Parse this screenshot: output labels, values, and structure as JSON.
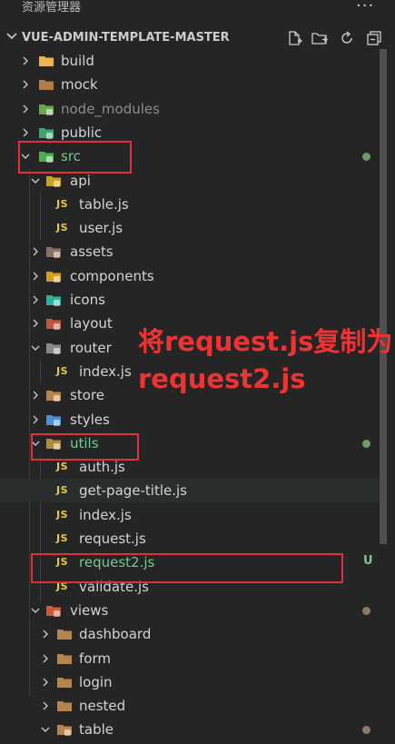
{
  "panel": {
    "title": "资源管理器",
    "more_icon": "ellipsis-icon"
  },
  "project": {
    "name": "VUE-ADMIN-TEMPLATE-MASTER",
    "actions": [
      "new-file-icon",
      "new-folder-icon",
      "refresh-icon",
      "collapse-all-icon"
    ]
  },
  "tree": [
    {
      "label": "build",
      "type": "folder",
      "depth": 0,
      "expanded": false,
      "icon": "folder-yellow"
    },
    {
      "label": "mock",
      "type": "folder",
      "depth": 0,
      "expanded": false,
      "icon": "folder-brown"
    },
    {
      "label": "node_modules",
      "type": "folder",
      "depth": 0,
      "expanded": false,
      "icon": "folder-node",
      "dim": true
    },
    {
      "label": "public",
      "type": "folder",
      "depth": 0,
      "expanded": false,
      "icon": "folder-public"
    },
    {
      "label": "src",
      "type": "folder",
      "depth": 0,
      "expanded": true,
      "icon": "folder-src",
      "status": "green-dot",
      "labelColor": "green"
    },
    {
      "label": "api",
      "type": "folder",
      "depth": 1,
      "expanded": true,
      "icon": "folder-api"
    },
    {
      "label": "table.js",
      "type": "js",
      "depth": 2
    },
    {
      "label": "user.js",
      "type": "js",
      "depth": 2
    },
    {
      "label": "assets",
      "type": "folder",
      "depth": 1,
      "expanded": false,
      "icon": "folder-assets"
    },
    {
      "label": "components",
      "type": "folder",
      "depth": 1,
      "expanded": false,
      "icon": "folder-components"
    },
    {
      "label": "icons",
      "type": "folder",
      "depth": 1,
      "expanded": false,
      "icon": "folder-icons"
    },
    {
      "label": "layout",
      "type": "folder",
      "depth": 1,
      "expanded": false,
      "icon": "folder-layout"
    },
    {
      "label": "router",
      "type": "folder",
      "depth": 1,
      "expanded": true,
      "icon": "folder-router"
    },
    {
      "label": "index.js",
      "type": "js",
      "depth": 2
    },
    {
      "label": "store",
      "type": "folder",
      "depth": 1,
      "expanded": false,
      "icon": "folder-store"
    },
    {
      "label": "styles",
      "type": "folder",
      "depth": 1,
      "expanded": false,
      "icon": "folder-styles"
    },
    {
      "label": "utils",
      "type": "folder",
      "depth": 1,
      "expanded": true,
      "icon": "folder-utils",
      "status": "green-dot",
      "labelColor": "green"
    },
    {
      "label": "auth.js",
      "type": "js",
      "depth": 2
    },
    {
      "label": "get-page-title.js",
      "type": "js",
      "depth": 2,
      "hover": true
    },
    {
      "label": "index.js",
      "type": "js",
      "depth": 2
    },
    {
      "label": "request.js",
      "type": "js",
      "depth": 2
    },
    {
      "label": "request2.js",
      "type": "js",
      "depth": 2,
      "status": "U",
      "labelColor": "green"
    },
    {
      "label": "validate.js",
      "type": "js",
      "depth": 2
    },
    {
      "label": "views",
      "type": "folder",
      "depth": 1,
      "expanded": true,
      "icon": "folder-views",
      "status": "brown-dot"
    },
    {
      "label": "dashboard",
      "type": "folder",
      "depth": 2,
      "expanded": false,
      "icon": "folder-plain"
    },
    {
      "label": "form",
      "type": "folder",
      "depth": 2,
      "expanded": false,
      "icon": "folder-plain"
    },
    {
      "label": "login",
      "type": "folder",
      "depth": 2,
      "expanded": false,
      "icon": "folder-plain"
    },
    {
      "label": "nested",
      "type": "folder",
      "depth": 2,
      "expanded": false,
      "icon": "folder-plain"
    },
    {
      "label": "table",
      "type": "folder",
      "depth": 2,
      "expanded": true,
      "icon": "folder-plain-open",
      "status": "brown-dot"
    }
  ],
  "js_badge": "JS",
  "annotation": {
    "line1": "将request.js复制为",
    "line2": "request2.js",
    "color": "#ee3333"
  },
  "colors": {
    "background": "#252526",
    "highlight_box": "#e0313a",
    "git_untracked": "#73c991"
  }
}
